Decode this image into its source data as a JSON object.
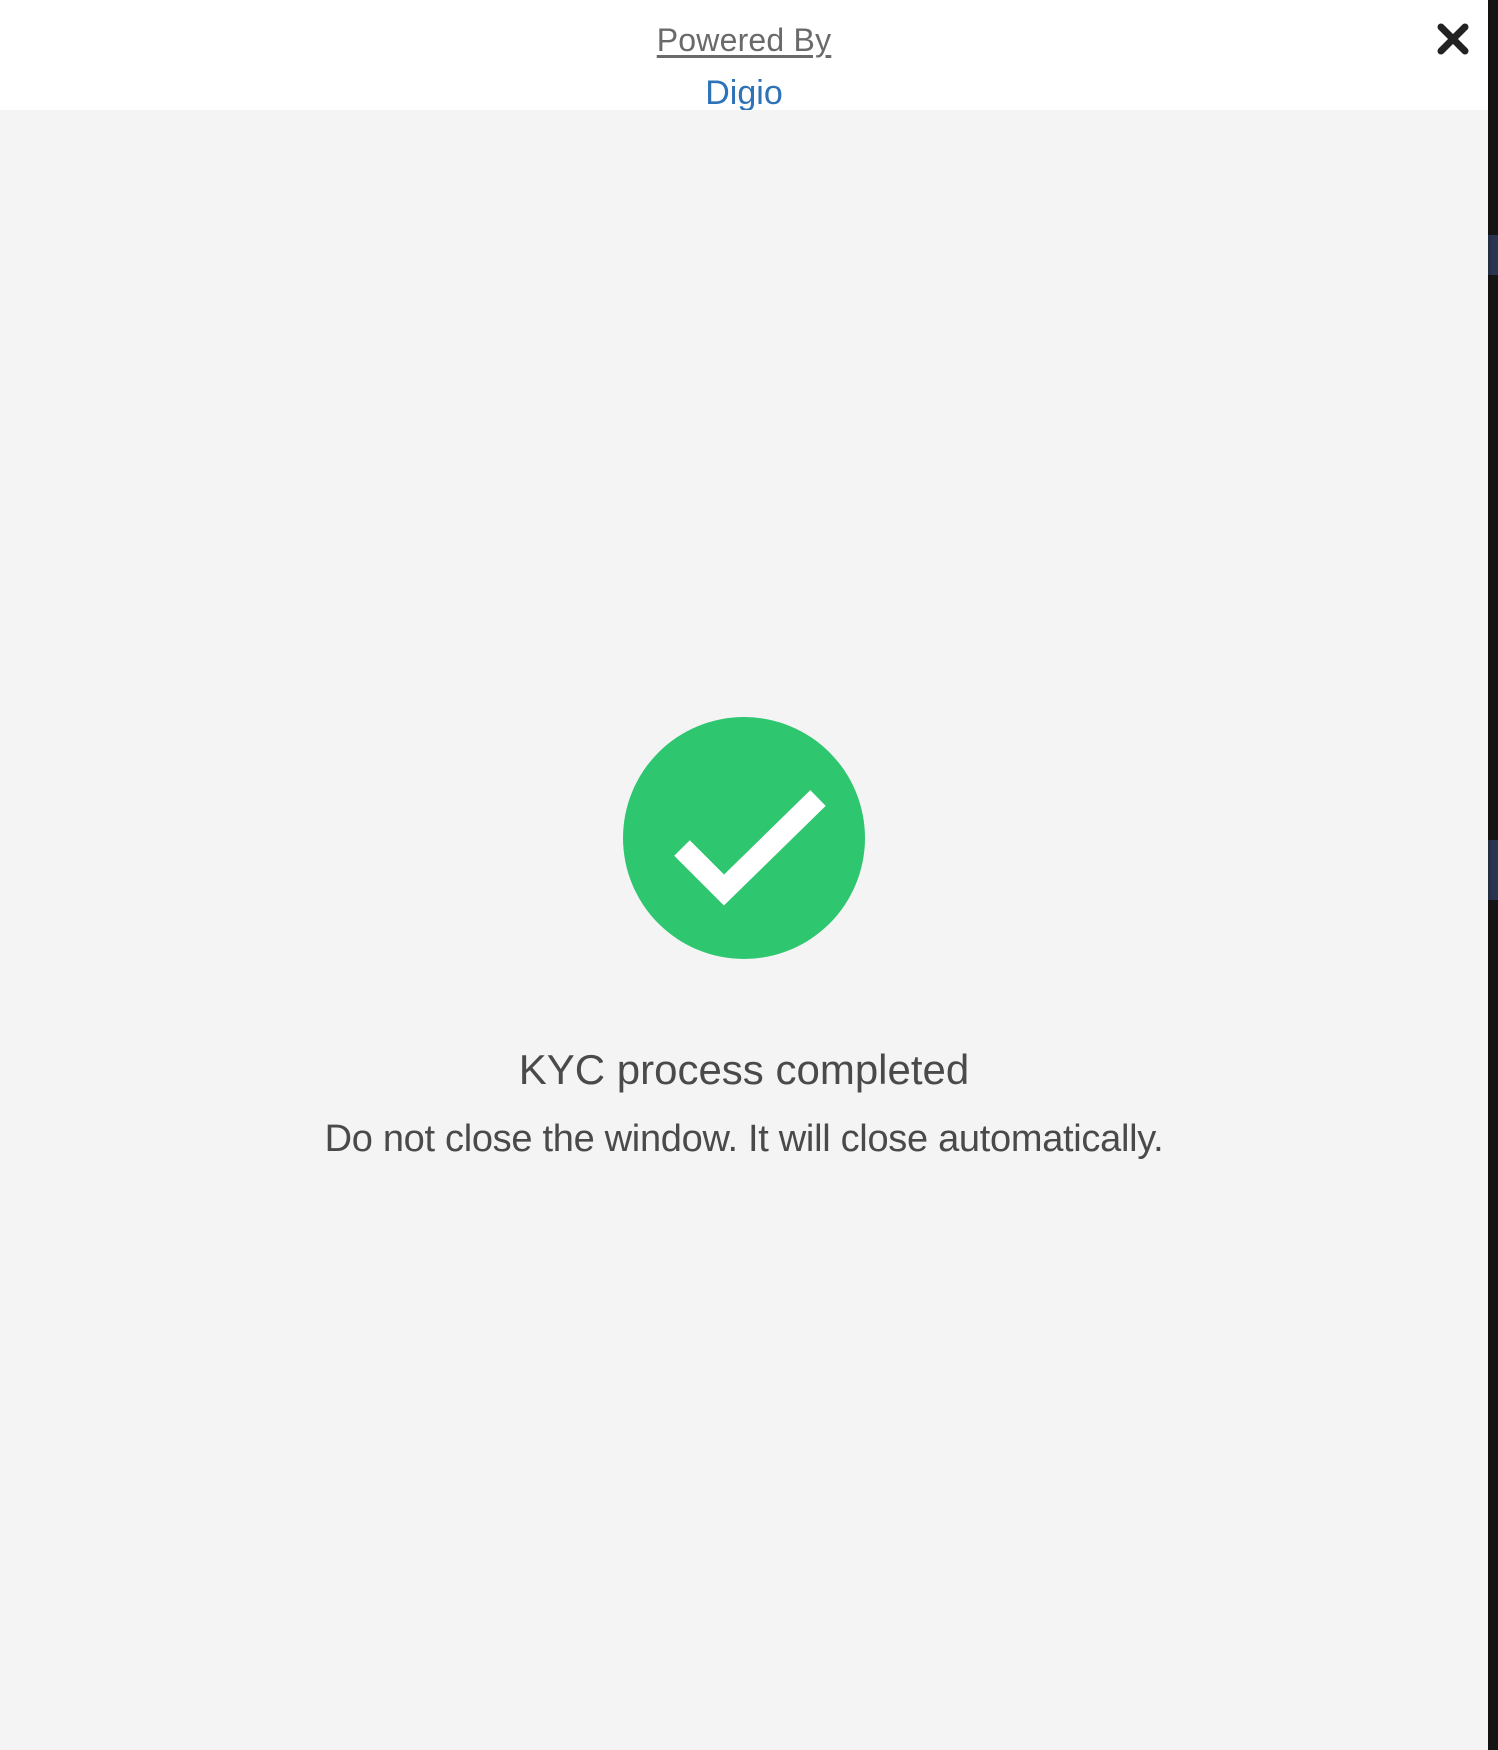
{
  "header": {
    "powered_by_label": "Powered By",
    "brand_label": "Digio"
  },
  "close_button": {
    "icon": "close-icon"
  },
  "status": {
    "icon": "check-circle-icon",
    "title": "KYC process completed",
    "message": "Do not close the window. It will close automatically."
  },
  "colors": {
    "success": "#2ec66f",
    "brand": "#2e73b8",
    "text": "#4a4a4a",
    "panel_background": "#f4f4f4"
  }
}
